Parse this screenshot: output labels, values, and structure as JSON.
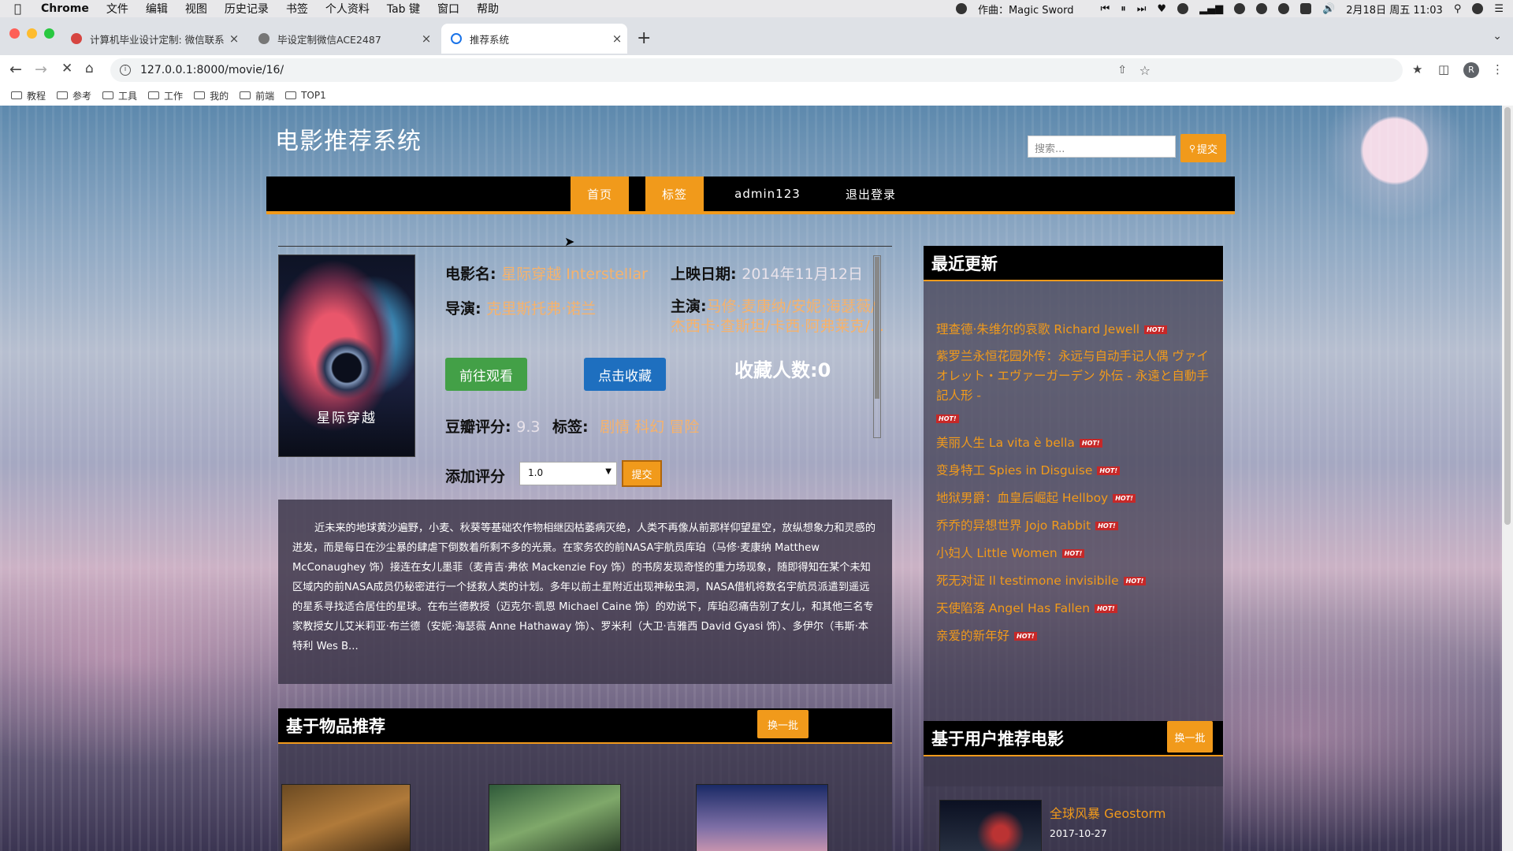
{
  "menubar": {
    "app": "Chrome",
    "items": [
      "文件",
      "编辑",
      "视图",
      "历史记录",
      "书签",
      "个人资料",
      "Tab 键",
      "窗口",
      "帮助"
    ],
    "now_playing": "作曲：Magic Sword",
    "datetime": "2月18日 周五 11:03"
  },
  "tabs": [
    {
      "title": "计算机毕业设计定制: 微信联系方"
    },
    {
      "title": "毕设定制微信ACE2487"
    },
    {
      "title": "推荐系统"
    }
  ],
  "toolbar": {
    "url": "127.0.0.1:8000/movie/16/",
    "avatar_letter": "R"
  },
  "bookmarks": [
    "教程",
    "参考",
    "工具",
    "工作",
    "我的",
    "前端",
    "TOP1"
  ],
  "site": {
    "title": "电影推荐系统",
    "search_placeholder": "搜索...",
    "search_button": "提交",
    "nav": [
      "首页",
      "标签",
      "admin123",
      "退出登录"
    ]
  },
  "movie": {
    "poster_title": "星际穿越",
    "name_label": "电影名:",
    "name": "星际穿越 Interstellar",
    "release_label": "上映日期:",
    "release": "2014年11月12日",
    "director_label": "导演:",
    "director": "克里斯托弗·诺兰",
    "cast_label": "主演:",
    "cast_line1": "马修·麦康纳/安妮·海瑟薇/",
    "cast_line2": "杰西卡·查斯坦/卡西·阿弗莱克/...",
    "watch_button": "前往观看",
    "fav_button": "点击收藏",
    "fav_count": "收藏人数:0",
    "douban_label": "豆瓣评分:",
    "douban_score": "9.3",
    "tags_label": "标签:",
    "tags": "剧情 科幻 冒险",
    "rate_label": "添加评分",
    "rate_value": "1.0",
    "rate_button": "提交",
    "synopsis": "近未来的地球黄沙遍野，小麦、秋葵等基础农作物相继因枯萎病灭绝，人类不再像从前那样仰望星空，放纵想象力和灵感的迸发，而是每日在沙尘暴的肆虐下倒数着所剩不多的光景。在家务农的前NASA宇航员库珀（马修·麦康纳 Matthew McConaughey 饰）接连在女儿墨菲（麦肯吉·弗依 Mackenzie Foy 饰）的书房发现奇怪的重力场现象，随即得知在某个未知区域内的前NASA成员仍秘密进行一个拯救人类的计划。多年以前土星附近出现神秘虫洞，NASA借机将数名宇航员派遣到遥远的星系寻找适合居住的星球。在布兰德教授（迈克尔·凯恩 Michael Caine 饰）的劝说下，库珀忍痛告别了女儿，和其他三名专家教授女儿艾米莉亚·布兰德（安妮·海瑟薇 Anne Hathaway 饰）、罗米利（大卫·吉雅西 David Gyasi 饰）、多伊尔（韦斯·本特利 Wes B..."
  },
  "recent": {
    "title": "最近更新",
    "hot_badge": "HOT!",
    "items": [
      "理查德·朱维尔的哀歌 Richard Jewell",
      "紫罗兰永恒花园外传：永远与自动手记人偶 ヴァイオレット・エヴァーガーデン 外伝 - 永遠と自動手記人形 -",
      "美丽人生 La vita è bella",
      "变身特工 Spies in Disguise",
      "地狱男爵：血皇后崛起 Hellboy",
      "乔乔的异想世界 Jojo Rabbit",
      "小妇人 Little Women",
      "死无对证 Il testimone invisibile",
      "天使陷落 Angel Has Fallen",
      "亲爱的新年好"
    ]
  },
  "item_based": {
    "title": "基于物品推荐",
    "swap": "换一批"
  },
  "user_based": {
    "title": "基于用户推荐电影",
    "swap": "换一批",
    "first_title": "全球风暴 Geostorm",
    "first_date": "2017-10-27"
  },
  "colors": {
    "accent": "#f19a1b",
    "nav_bg": "#000000",
    "watch_button": "#43a047",
    "fav_button": "#1e6fbf",
    "hot_badge": "#c62828"
  }
}
